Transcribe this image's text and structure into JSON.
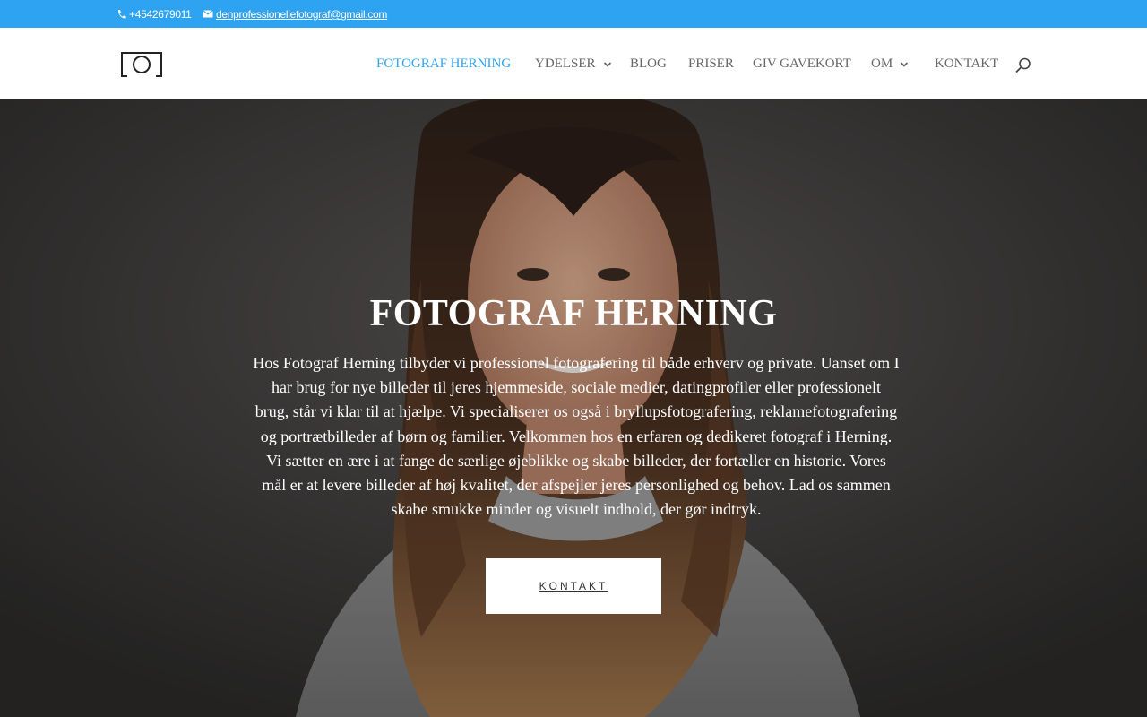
{
  "topbar": {
    "phone": "+4542679011",
    "email": "denprofessionellefotograf@gmail.com",
    "phone_icon": "phone-icon",
    "email_icon": "envelope-icon",
    "background": "#2ea3f2"
  },
  "header": {
    "logo_icon": "camera-frame-logo",
    "nav": [
      {
        "label": "FOTOGRAF HERNING",
        "active": true
      },
      {
        "label": "YDELSER",
        "dropdown": true
      },
      {
        "label": "BLOG"
      },
      {
        "label": "PRISER"
      },
      {
        "label": "GIV GAVEKORT"
      },
      {
        "label": "OM",
        "dropdown": true
      },
      {
        "label": "KONTAKT"
      }
    ],
    "search_icon": "search-icon",
    "accent": "#2ea3f2"
  },
  "hero": {
    "title": "FOTOGRAF HERNING",
    "text": "Hos Fotograf Herning tilbyder vi professionel fotografering til både erhverv og private. Uanset om I har brug for nye billeder til jeres hjemmeside, sociale medier, datingprofiler eller professionelt brug, står vi klar til at hjælpe. Vi specialiserer os også i bryllupsfotografering, reklamefotografering og portrætbilleder af børn og familier. Velkommen hos en erfaren og dedikeret fotograf i Herning. Vi sætter en ære i at fange de særlige øjeblikke og skabe billeder, der fortæller en historie. Vores mål er at levere billeder af høj kvalitet, der afspejler jeres personlighed og behov. Lad os sammen skabe smukke minder og visuelt indhold, der gør indtryk.",
    "button_label": "KONTAKT"
  }
}
